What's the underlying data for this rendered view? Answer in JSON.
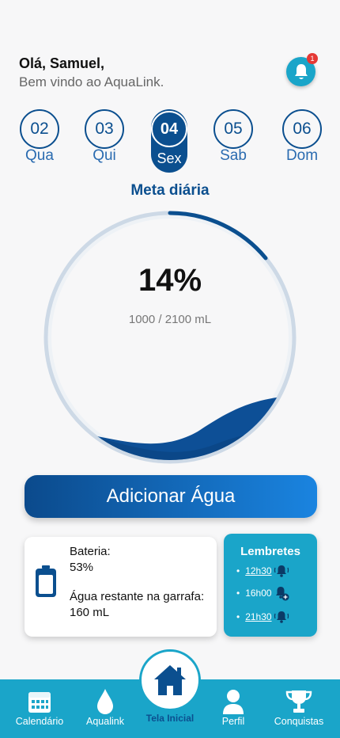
{
  "header": {
    "greeting": "Olá, Samuel,",
    "subtitle": "Bem vindo ao AquaLink.",
    "notification_count": "1"
  },
  "days": [
    {
      "num": "02",
      "label": "Qua"
    },
    {
      "num": "03",
      "label": "Qui"
    },
    {
      "num": "04",
      "label": "Sex",
      "active": true
    },
    {
      "num": "05",
      "label": "Sab"
    },
    {
      "num": "06",
      "label": "Dom"
    }
  ],
  "goal": {
    "title": "Meta diária",
    "percent_text": "14%",
    "amount_text": "1000 / 2100 mL",
    "progress": 0.14
  },
  "add_button": "Adicionar Água",
  "battery": {
    "label": "Bateria:",
    "value": "53%",
    "remaining_label": "Água restante na garrafa:",
    "remaining_value": "160 mL"
  },
  "reminders": {
    "title": "Lembretes",
    "items": [
      {
        "time": "12h30",
        "icon": "bell-ringing-icon"
      },
      {
        "time": "16h00",
        "icon": "bell-add-icon"
      },
      {
        "time": "21h30",
        "icon": "bell-ringing-icon"
      }
    ]
  },
  "nav": {
    "calendar": "Calendário",
    "aqualink": "Aqualink",
    "home": "Tela Inicial",
    "profile": "Perfil",
    "achievements": "Conquistas"
  },
  "colors": {
    "primary": "#0b4f8f",
    "accent": "#1aa5c9",
    "badge": "#e53935"
  }
}
